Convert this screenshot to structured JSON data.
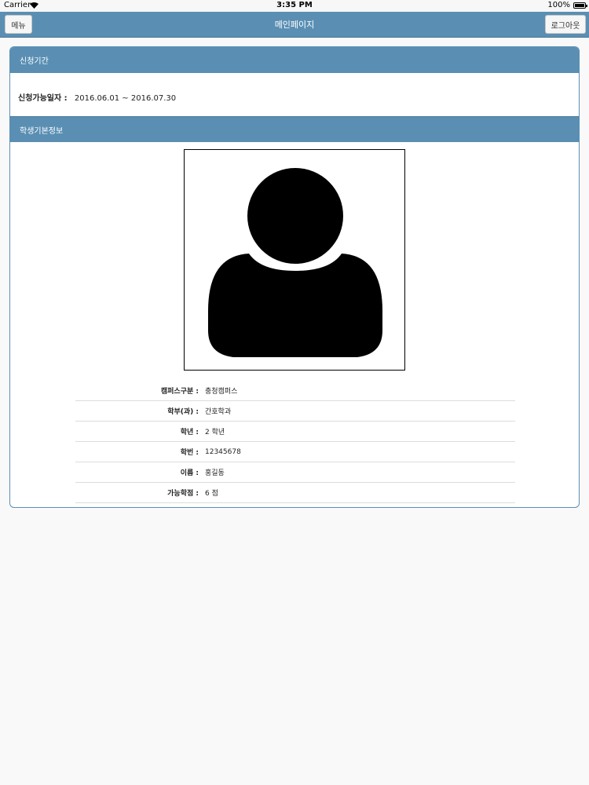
{
  "status_bar": {
    "carrier": "Carrier",
    "time": "3:35 PM",
    "battery": "100%"
  },
  "navbar": {
    "menu_label": "메뉴",
    "title": "메인페이지",
    "logout_label": "로그아웃"
  },
  "period_section": {
    "title": "신청기간",
    "label": "신청가능일자 :",
    "value": "2016.06.01 ~ 2016.07.30"
  },
  "student_section": {
    "title": "학생기본정보",
    "photo_icon": "user-silhouette-icon",
    "rows": [
      {
        "label": "캠퍼스구분 :",
        "value": "충청캠퍼스"
      },
      {
        "label": "학부(과) :",
        "value": "간호학과"
      },
      {
        "label": "학년 :",
        "value": "2 학년"
      },
      {
        "label": "학번 :",
        "value": "12345678"
      },
      {
        "label": "이름 :",
        "value": "홍길동"
      },
      {
        "label": "가능학점 :",
        "value": "6 점"
      }
    ]
  },
  "colors": {
    "header": "#5a8fb3",
    "background": "#f9f9fa"
  }
}
